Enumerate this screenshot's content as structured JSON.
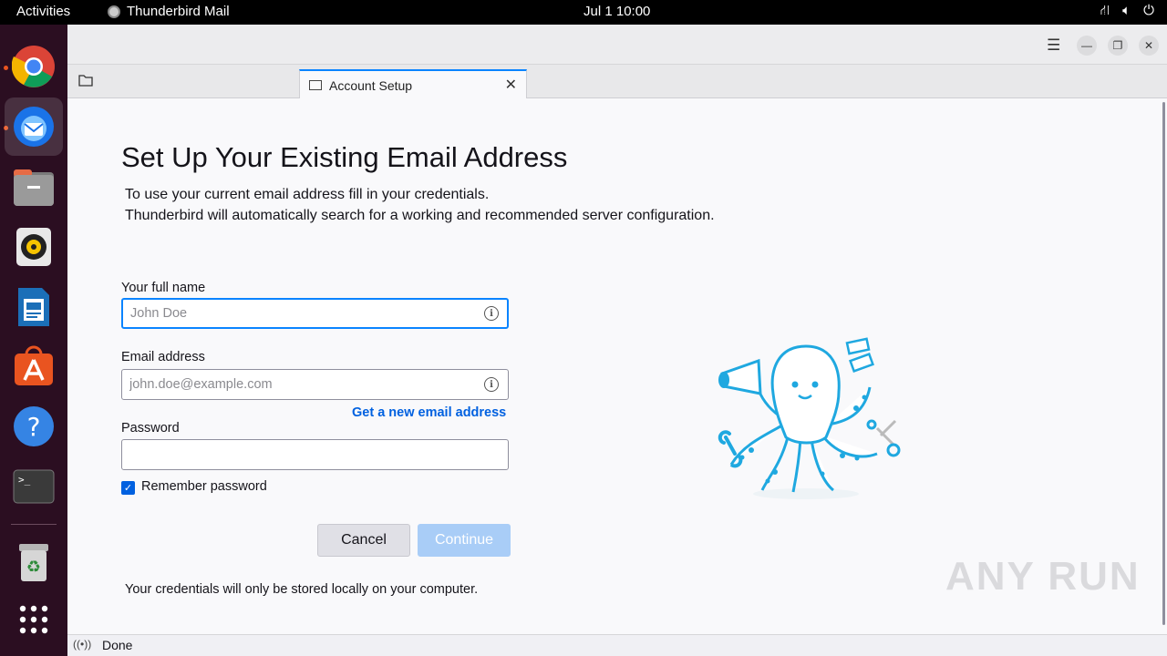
{
  "topbar": {
    "activities": "Activities",
    "app_name": "Thunderbird Mail",
    "clock": "Jul 1  10:00"
  },
  "dock": {
    "items": [
      "chrome",
      "thunderbird",
      "files",
      "rhythmbox",
      "libreoffice-writer",
      "app-center",
      "help",
      "terminal",
      "trash",
      "show-apps"
    ]
  },
  "tabs": [
    {
      "label": "Account Setup"
    }
  ],
  "setup": {
    "title": "Set Up Your Existing Email Address",
    "intro_line1": "To use your current email address fill in your credentials.",
    "intro_line2": "Thunderbird will automatically search for a working and recommended server configuration.",
    "name_label": "Your full name",
    "name_placeholder": "John Doe",
    "email_label": "Email address",
    "email_placeholder": "john.doe@example.com",
    "new_email_link": "Get a new email address",
    "password_label": "Password",
    "remember_label": "Remember password",
    "remember_checked": true,
    "cancel_label": "Cancel",
    "continue_label": "Continue",
    "footnote": "Your credentials will only be stored locally on your computer."
  },
  "watermark": "ANY RUN",
  "status": {
    "text": "Done"
  },
  "colors": {
    "accent": "#0061e0",
    "focus": "#0a84ff",
    "dock_bg": "#2b0e21",
    "mascot": "#1fa8e0"
  }
}
